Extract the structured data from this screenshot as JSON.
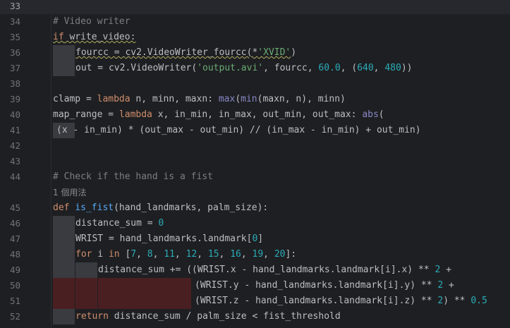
{
  "editor": {
    "line_numbers": [
      "33",
      "34",
      "35",
      "36",
      "37",
      "38",
      "39",
      "40",
      "41",
      "42",
      "43",
      "44",
      "45",
      "46",
      "47",
      "48",
      "49",
      "50",
      "51",
      "52"
    ],
    "usages_hint": "1 個用法",
    "lines": {
      "l34": [
        "# Video writer"
      ],
      "l35": [
        "if",
        " write_video:"
      ],
      "l36": [
        "fourcc = cv2.VideoWriter_fourcc(*",
        "'XVID'",
        ")"
      ],
      "l37": [
        "out = cv2.VideoWriter(",
        "'output.avi'",
        ", fourcc, ",
        "60.0",
        ", (",
        "640",
        ", ",
        "480",
        "))"
      ],
      "l39": [
        "clamp = ",
        "lambda",
        " n, minn, maxn: ",
        "max",
        "(",
        "min",
        "(maxn, n), minn)"
      ],
      "l40": [
        "map_range = ",
        "lambda",
        " x, in_min, in_max, out_min, out_max: ",
        "abs",
        "("
      ],
      "l41": [
        "(x - in_min) * (out_max - out_min) // (in_max - in_min) + out_min)"
      ],
      "l44": [
        "# Check if the hand is a fist"
      ],
      "l45": [
        "def",
        " ",
        "is_fist",
        "(hand_landmarks, palm_size):"
      ],
      "l46": [
        "distance_sum = ",
        "0"
      ],
      "l47": [
        "WRIST = hand_landmarks.landmark[",
        "0",
        "]"
      ],
      "l48": [
        "for",
        " i ",
        "in",
        " [",
        "7",
        ", ",
        "8",
        ", ",
        "11",
        ", ",
        "12",
        ", ",
        "15",
        ", ",
        "16",
        ", ",
        "19",
        ", ",
        "20",
        "]:"
      ],
      "l49": [
        "distance_sum += ((WRIST.x - hand_landmarks.landmark[i].x) ** ",
        "2",
        " +"
      ],
      "l50": [
        "(WRIST.y - hand_landmarks.landmark[i].y) ** ",
        "2",
        " +"
      ],
      "l51": [
        "(WRIST.z - hand_landmarks.landmark[i].z) ** ",
        "2",
        ") ** ",
        "0.5"
      ],
      "l52": [
        "return",
        " distance_sum / palm_size < fist_threshold"
      ]
    }
  }
}
